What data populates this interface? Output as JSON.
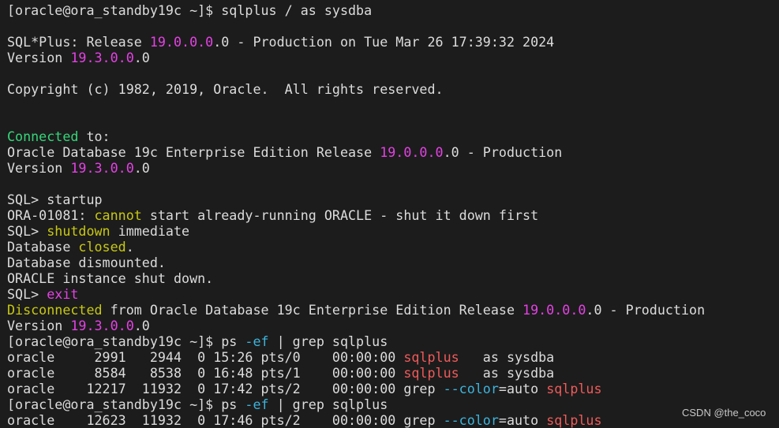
{
  "colors": {
    "default": "#dcdcdc",
    "number": "#e442e4",
    "green": "#35d67a",
    "yellow": "#c8c812",
    "red": "#f05a5a",
    "cyan": "#3cb4dc",
    "background": "#1c1c1c"
  },
  "terminal": {
    "lines": [
      [
        [
          "[oracle@ora_standby19c ~]$ sqlplus / as sysdba",
          "default"
        ]
      ],
      [],
      [
        [
          "SQL*Plus: Release ",
          "default"
        ],
        [
          "19.0.0.0",
          "number"
        ],
        [
          ".0 - Production on Tue Mar 26 17:39:32 2024",
          "default"
        ]
      ],
      [
        [
          "Version ",
          "default"
        ],
        [
          "19.3.0.0",
          "number"
        ],
        [
          ".0",
          "default"
        ]
      ],
      [],
      [
        [
          "Copyright (c) 1982, 2019, Oracle.  All rights reserved.",
          "default"
        ]
      ],
      [],
      [],
      [
        [
          "Connected",
          "green"
        ],
        [
          " to:",
          "default"
        ]
      ],
      [
        [
          "Oracle Database 19c Enterprise Edition Release ",
          "default"
        ],
        [
          "19.0.0.0",
          "number"
        ],
        [
          ".0 - Production",
          "default"
        ]
      ],
      [
        [
          "Version ",
          "default"
        ],
        [
          "19.3.0.0",
          "number"
        ],
        [
          ".0",
          "default"
        ]
      ],
      [],
      [
        [
          "SQL> startup",
          "default"
        ]
      ],
      [
        [
          "ORA-01081: ",
          "default"
        ],
        [
          "cannot",
          "yellow"
        ],
        [
          " start already-running ORACLE - shut it down first",
          "default"
        ]
      ],
      [
        [
          "SQL> ",
          "default"
        ],
        [
          "shutdown",
          "yellow"
        ],
        [
          " immediate",
          "default"
        ]
      ],
      [
        [
          "Database ",
          "default"
        ],
        [
          "closed",
          "yellow"
        ],
        [
          ".",
          "default"
        ]
      ],
      [
        [
          "Database dismounted.",
          "default"
        ]
      ],
      [
        [
          "ORACLE instance shut down.",
          "default"
        ]
      ],
      [
        [
          "SQL> ",
          "default"
        ],
        [
          "exit",
          "number"
        ]
      ],
      [
        [
          "Disconnected",
          "yellow"
        ],
        [
          " from Oracle Database 19c Enterprise Edition Release ",
          "default"
        ],
        [
          "19.0.0.0",
          "number"
        ],
        [
          ".0 - Production",
          "default"
        ]
      ],
      [
        [
          "Version ",
          "default"
        ],
        [
          "19.3.0.0",
          "number"
        ],
        [
          ".0",
          "default"
        ]
      ],
      [
        [
          "[oracle@ora_standby19c ~]$ ps ",
          "default"
        ],
        [
          "-ef",
          "cyan"
        ],
        [
          " | grep sqlplus",
          "default"
        ]
      ],
      [
        [
          "oracle     2991   2944  0 15:26 pts/0    00:00:00 ",
          "default"
        ],
        [
          "sqlplus",
          "red"
        ],
        [
          "   as sysdba",
          "default"
        ]
      ],
      [
        [
          "oracle     8584   8538  0 16:48 pts/1    00:00:00 ",
          "default"
        ],
        [
          "sqlplus",
          "red"
        ],
        [
          "   as sysdba",
          "default"
        ]
      ],
      [
        [
          "oracle    12217  11932  0 17:42 pts/2    00:00:00 grep ",
          "default"
        ],
        [
          "--color",
          "cyan"
        ],
        [
          "=auto ",
          "default"
        ],
        [
          "sqlplus",
          "red"
        ]
      ],
      [
        [
          "[oracle@ora_standby19c ~]$ ps ",
          "default"
        ],
        [
          "-ef",
          "cyan"
        ],
        [
          " | grep sqlplus",
          "default"
        ]
      ],
      [
        [
          "oracle    12623  11932  0 17:46 pts/2    00:00:00 grep ",
          "default"
        ],
        [
          "--color",
          "cyan"
        ],
        [
          "=auto ",
          "default"
        ],
        [
          "sqlplus",
          "red"
        ]
      ]
    ]
  },
  "watermark": "CSDN @the_coco"
}
